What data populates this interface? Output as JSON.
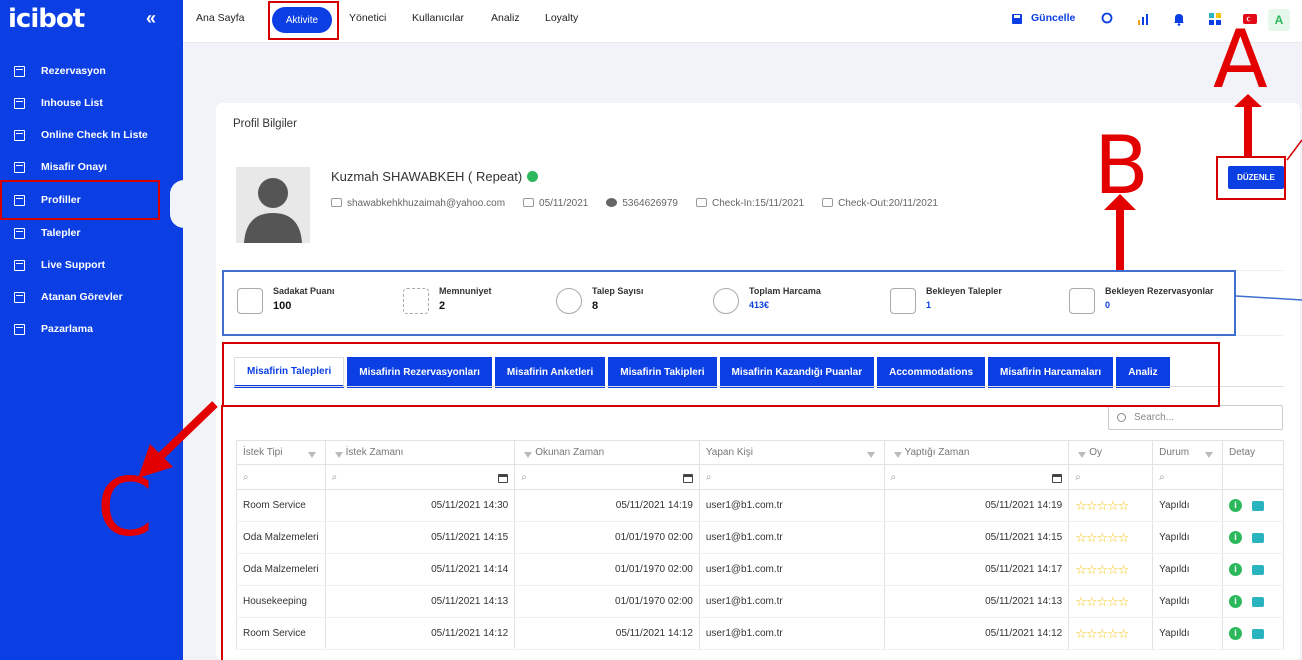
{
  "sidebar": {
    "logo": "icibot",
    "collapse_icon": "«",
    "items": [
      {
        "label": "Rezervasyon"
      },
      {
        "label": "Inhouse List"
      },
      {
        "label": "Online Check In Liste"
      },
      {
        "label": "Misafir Onayı"
      },
      {
        "label": "Profiller"
      },
      {
        "label": "Talepler"
      },
      {
        "label": "Live Support"
      },
      {
        "label": "Atanan Görevler"
      },
      {
        "label": "Pazarlama"
      }
    ]
  },
  "topbar": {
    "nav": [
      "Ana Sayfa",
      "Aktivite",
      "Yönetici",
      "Kullanıcılar",
      "Analiz",
      "Loyalty"
    ],
    "update_label": "Güncelle",
    "avatar_letter": "A",
    "icons": [
      "save-icon",
      "search-icon",
      "chart-icon",
      "bell-icon",
      "apps-icon",
      "flag-icon"
    ]
  },
  "profile": {
    "section_title": "Profil Bilgiler",
    "name": "Kuzmah SHAWABKEH ( Repeat)",
    "email": "shawabkehkhuzaimah@yahoo.com",
    "date": "05/11/2021",
    "phone": "5364626979",
    "checkin": "Check-In:15/11/2021",
    "checkout": "Check-Out:20/11/2021",
    "edit_label": "DÜZENLE"
  },
  "stats": [
    {
      "label": "Sadakat Puanı",
      "value": "100"
    },
    {
      "label": "Memnuniyet",
      "value": "2"
    },
    {
      "label": "Talep Sayısı",
      "value": "8"
    },
    {
      "label": "Toplam Harcama",
      "value": "413€"
    },
    {
      "label": "Bekleyen Talepler",
      "value": "1"
    },
    {
      "label": "Bekleyen Rezervasyonlar",
      "value": "0"
    }
  ],
  "tabs": [
    "Misafirin Talepleri",
    "Misafirin Rezervasyonları",
    "Misafirin Anketleri",
    "Misafirin Takipleri",
    "Misafirin Kazandığı Puanlar",
    "Accommodations",
    "Misafirin Harcamaları",
    "Analiz"
  ],
  "search_placeholder": "Search...",
  "table": {
    "headers": [
      "İstek Tipi",
      "İstek Zamanı",
      "Okunan Zaman",
      "Yapan Kişi",
      "Yaptığı Zaman",
      "Oy",
      "Durum",
      "Detay"
    ],
    "rows": [
      {
        "tip": "Room Service",
        "istek": "05/11/2021 14:30",
        "okunan": "05/11/2021 14:19",
        "kisi": "user1@b1.com.tr",
        "yaptigi": "05/11/2021 14:19",
        "durum": "Yapıldı"
      },
      {
        "tip": "Oda Malzemeleri",
        "istek": "05/11/2021 14:15",
        "okunan": "01/01/1970 02:00",
        "kisi": "user1@b1.com.tr",
        "yaptigi": "05/11/2021 14:15",
        "durum": "Yapıldı"
      },
      {
        "tip": "Oda Malzemeleri",
        "istek": "05/11/2021 14:14",
        "okunan": "01/01/1970 02:00",
        "kisi": "user1@b1.com.tr",
        "yaptigi": "05/11/2021 14:17",
        "durum": "Yapıldı"
      },
      {
        "tip": "Housekeeping",
        "istek": "05/11/2021 14:13",
        "okunan": "01/01/1970 02:00",
        "kisi": "user1@b1.com.tr",
        "yaptigi": "05/11/2021 14:13",
        "durum": "Yapıldı"
      },
      {
        "tip": "Room Service",
        "istek": "05/11/2021 14:12",
        "okunan": "05/11/2021 14:12",
        "kisi": "user1@b1.com.tr",
        "yaptigi": "05/11/2021 14:12",
        "durum": "Yapıldı"
      }
    ]
  },
  "annotations": {
    "a": "A",
    "b": "B",
    "c": "C",
    "color": "#e30000"
  },
  "colors": {
    "primary": "#0b3fe3",
    "success": "#2eb85c",
    "star": "#f1c40f"
  }
}
